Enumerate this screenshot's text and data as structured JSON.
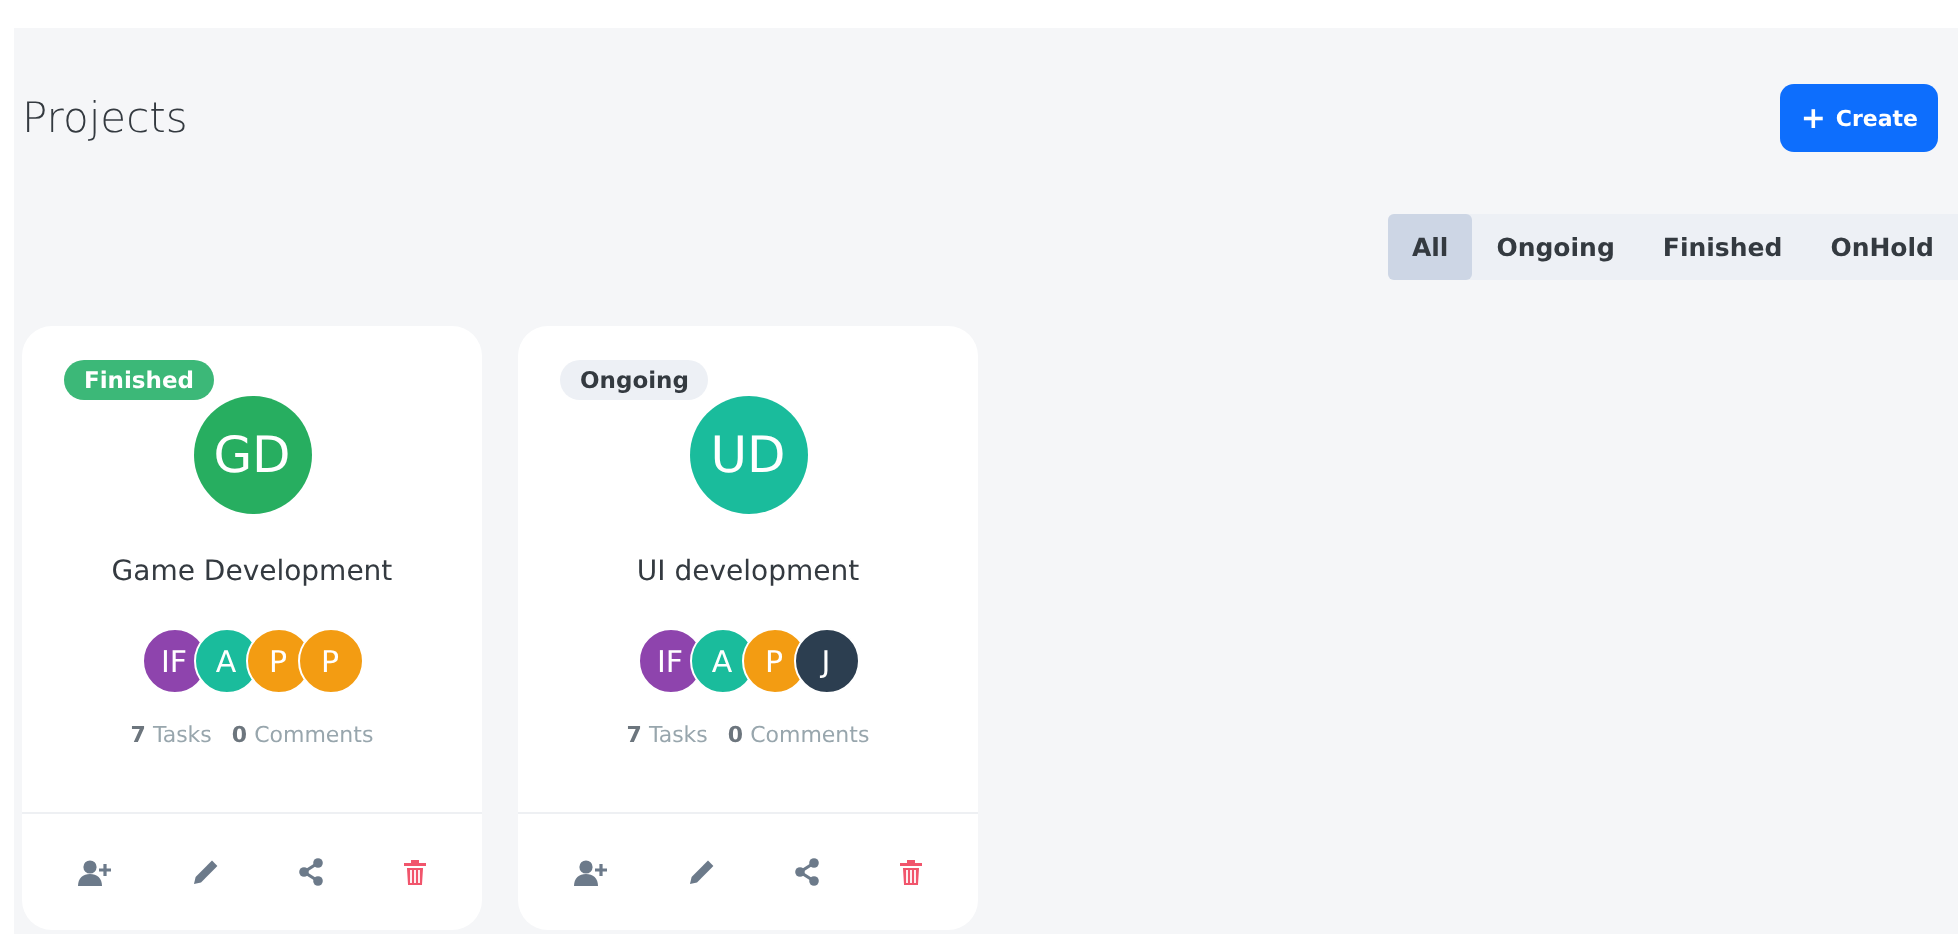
{
  "header": {
    "title": "Projects",
    "create_button": {
      "icon": "+",
      "label": "Create"
    }
  },
  "tabs": [
    {
      "label": "All",
      "selected": true
    },
    {
      "label": "Ongoing",
      "selected": false
    },
    {
      "label": "Finished",
      "selected": false
    },
    {
      "label": "OnHold",
      "selected": false
    }
  ],
  "projects": [
    {
      "status": {
        "kind": "finished",
        "label": "Finished"
      },
      "initials": "GD",
      "color": "#27ae60",
      "name": "Game Development",
      "members": [
        {
          "initials": "IF",
          "color": "#8e44ad"
        },
        {
          "initials": "A",
          "color": "#1abc9c"
        },
        {
          "initials": "P",
          "color": "#f39c12"
        },
        {
          "initials": "P",
          "color": "#f39c12"
        }
      ],
      "tasks": "7",
      "tasks_label": "Tasks",
      "comments": "0",
      "comments_label": "Comments"
    },
    {
      "status": {
        "kind": "ongoing",
        "label": "Ongoing"
      },
      "initials": "UD",
      "color": "#1abc9c",
      "name": "UI development",
      "members": [
        {
          "initials": "IF",
          "color": "#8e44ad"
        },
        {
          "initials": "A",
          "color": "#1abc9c"
        },
        {
          "initials": "P",
          "color": "#f39c12"
        },
        {
          "initials": "J",
          "color": "#2c3e50"
        }
      ],
      "tasks": "7",
      "tasks_label": "Tasks",
      "comments": "0",
      "comments_label": "Comments"
    }
  ]
}
